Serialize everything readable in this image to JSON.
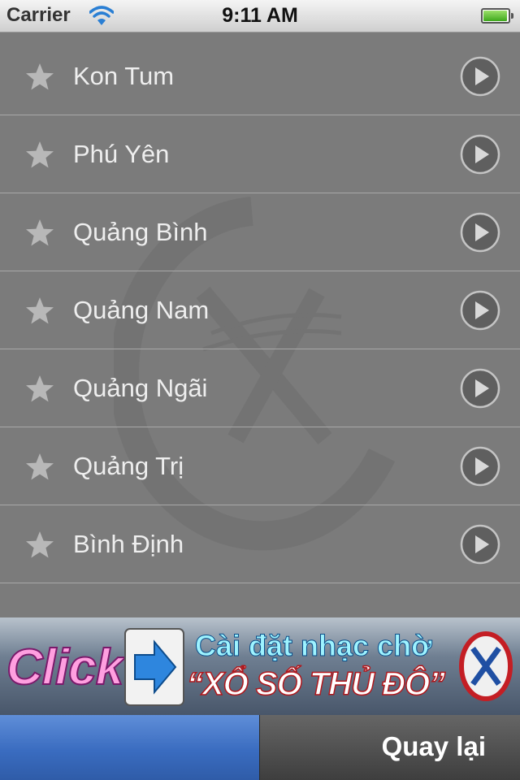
{
  "status_bar": {
    "carrier": "Carrier",
    "time": "9:11 AM",
    "battery_level": 0.95
  },
  "list": {
    "items": [
      {
        "label": "Kon Tum"
      },
      {
        "label": "Phú Yên"
      },
      {
        "label": "Quảng Bình"
      },
      {
        "label": "Quảng Nam"
      },
      {
        "label": "Quảng Ngãi"
      },
      {
        "label": "Quảng Trị"
      },
      {
        "label": "Bình Định"
      }
    ]
  },
  "ad": {
    "click_text": "Click",
    "line1": "Cài đặt nhạc chờ",
    "line2": "“XỔ SỐ THỦ ĐÔ”"
  },
  "tab_bar": {
    "back_label": "Quay lại"
  },
  "colors": {
    "background": "#7b7b7b",
    "divider": "#a8a8a8",
    "tab_active": "#3a6cc0"
  },
  "icons": {
    "row_leading": "star-icon",
    "row_trailing": "play-icon"
  }
}
